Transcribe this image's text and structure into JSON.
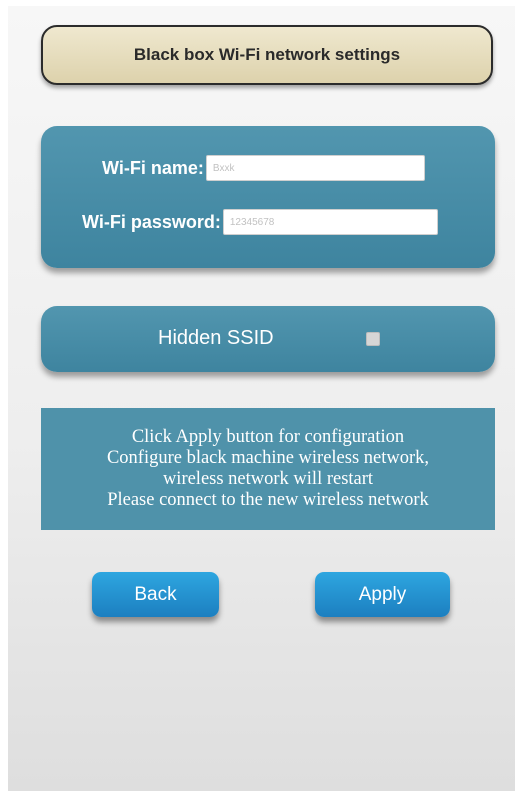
{
  "header": {
    "title": "Black box Wi-Fi network settings"
  },
  "wifi": {
    "name_label": "Wi-Fi name:",
    "name_value": "Bxxk",
    "password_label": "Wi-Fi password:",
    "password_value": "12345678"
  },
  "ssid": {
    "label": "Hidden SSID",
    "checked": false
  },
  "info": {
    "lines": [
      "Click Apply button for configuration",
      "Configure black machine wireless network,",
      "wireless network will restart",
      "Please connect to the new wireless network"
    ]
  },
  "buttons": {
    "back_label": "Back",
    "apply_label": "Apply"
  },
  "colors": {
    "panel": "#4a8ea8",
    "title_bg": "#e6dcb9",
    "button": "#2590d0"
  }
}
